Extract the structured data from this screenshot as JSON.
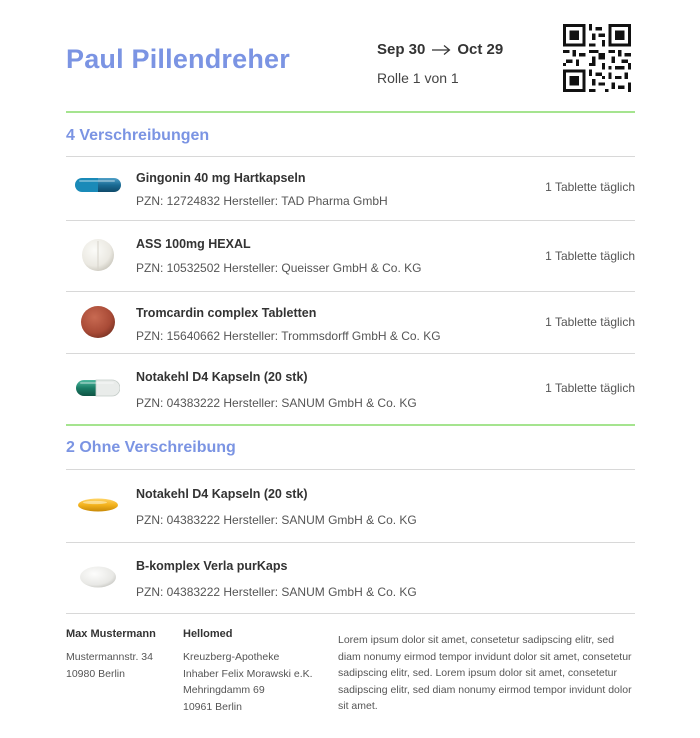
{
  "header": {
    "patient_name": "Paul Pillendreher",
    "date_from": "Sep 30",
    "date_to": "Oct 29",
    "roll_info": "Rolle 1 von 1"
  },
  "sections": {
    "prescribed_title": "4 Verschreibungen",
    "otc_title": "2 Ohne Verschreibung"
  },
  "prescribed": [
    {
      "name": "Gingonin 40 mg Hartkapseln",
      "meta": "PZN: 12724832 Hersteller: TAD Pharma GmbH",
      "dose": "1 Tablette täglich",
      "pill": "capsule-blue-icon"
    },
    {
      "name": "ASS 100mg HEXAL",
      "meta": "PZN: 10532502 Hersteller: Queisser GmbH & Co. KG",
      "dose": "1 Tablette täglich",
      "pill": "white-tablet-icon"
    },
    {
      "name": "Tromcardin complex Tabletten",
      "meta": "PZN: 15640662 Hersteller: Trommsdorff GmbH & Co. KG",
      "dose": "1 Tablette täglich",
      "pill": "red-tablet-icon"
    },
    {
      "name": "Notakehl D4 Kapseln (20 stk)",
      "meta": "PZN: 04383222 Hersteller: SANUM GmbH & Co. KG",
      "dose": "1 Tablette täglich",
      "pill": "capsule-green-icon"
    }
  ],
  "otc": [
    {
      "name": "Notakehl D4 Kapseln (20 stk)",
      "meta": "PZN: 04383222 Hersteller: SANUM GmbH & Co. KG",
      "pill": "yellow-softgel-icon"
    },
    {
      "name": "B-komplex Verla purKaps",
      "meta": "PZN: 04383222 Hersteller: SANUM GmbH & Co. KG",
      "pill": "white-oval-tablet-icon"
    }
  ],
  "footer": {
    "patient": {
      "name": "Max Mustermann",
      "street": "Mustermannstr. 34",
      "city": "10980 Berlin"
    },
    "pharmacy": {
      "name": "Hellomed",
      "line1": "Kreuzberg-Apotheke",
      "line2": "Inhaber Felix Morawski e.K.",
      "line3": "Mehringdamm 69",
      "line4": "10961 Berlin"
    },
    "text": "Lorem ipsum dolor sit amet, consetetur sadipscing elitr, sed diam nonumy eirmod tempor invidunt dolor sit amet, consetetur sadipscing elitr, sed. Lorem ipsum dolor sit amet, consetetur sadipscing elitr, sed diam nonumy eirmod tempor invidunt dolor sit amet."
  },
  "colors": {
    "accent": "#7b94e3",
    "divider": "#a5e48f"
  }
}
